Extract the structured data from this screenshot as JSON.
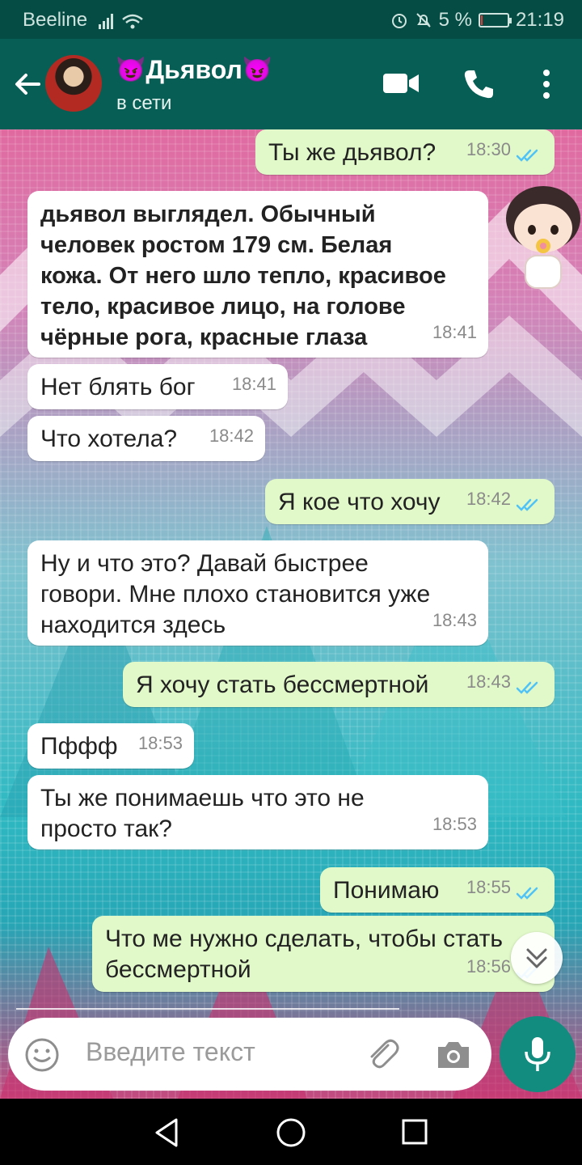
{
  "status_bar": {
    "carrier": "Beeline",
    "battery_percent": "5 %",
    "time": "21:19",
    "battery_level": 0.05
  },
  "header": {
    "contact_name": "Дьявол",
    "contact_emoji_left": "😈",
    "contact_emoji_right": "😈",
    "contact_status": "в сети"
  },
  "messages": [
    {
      "dir": "out",
      "lines": [
        "Ты же дьявол?"
      ],
      "time": "18:30",
      "read": true
    },
    {
      "dir": "in",
      "bold": true,
      "lines": [
        "дьявол выглядел. Обычный",
        "человек ростом 179 см. Белая",
        "кожа. От него шло тепло, красивое",
        "тело, красивое лицо, на голове",
        "чёрные рога, красные глаза"
      ],
      "time": "18:41"
    },
    {
      "dir": "in",
      "lines": [
        "Нет блять бог"
      ],
      "time": "18:41"
    },
    {
      "dir": "in",
      "lines": [
        "Что хотела?"
      ],
      "time": "18:42"
    },
    {
      "dir": "out",
      "lines": [
        "Я кое что хочу"
      ],
      "time": "18:42",
      "read": true
    },
    {
      "dir": "in",
      "lines": [
        "Ну и что это? Давай быстрее",
        "говори. Мне плохо становится уже",
        "находится здесь"
      ],
      "time": "18:43"
    },
    {
      "dir": "out",
      "lines": [
        "Я хочу стать бессмертной"
      ],
      "time": "18:43",
      "read": true
    },
    {
      "dir": "in",
      "lines": [
        "Пффф"
      ],
      "time": "18:53"
    },
    {
      "dir": "in",
      "lines": [
        "Ты же понимаешь что это не",
        "просто так?"
      ],
      "time": "18:53"
    },
    {
      "dir": "out",
      "lines": [
        "Понимаю"
      ],
      "time": "18:55",
      "read": true
    },
    {
      "dir": "out",
      "lines": [
        "Что ме нужно сделать, чтобы стать",
        "бессмертной"
      ],
      "time": "18:56",
      "read": true
    }
  ],
  "composer": {
    "placeholder": "Введите текст"
  },
  "colors": {
    "header": "#075e54",
    "status_bar": "#054d44",
    "bubble_in": "#ffffff",
    "bubble_out": "#e1f9c9",
    "read_ticks": "#4fc3f7",
    "mic_button": "#128c7e"
  }
}
